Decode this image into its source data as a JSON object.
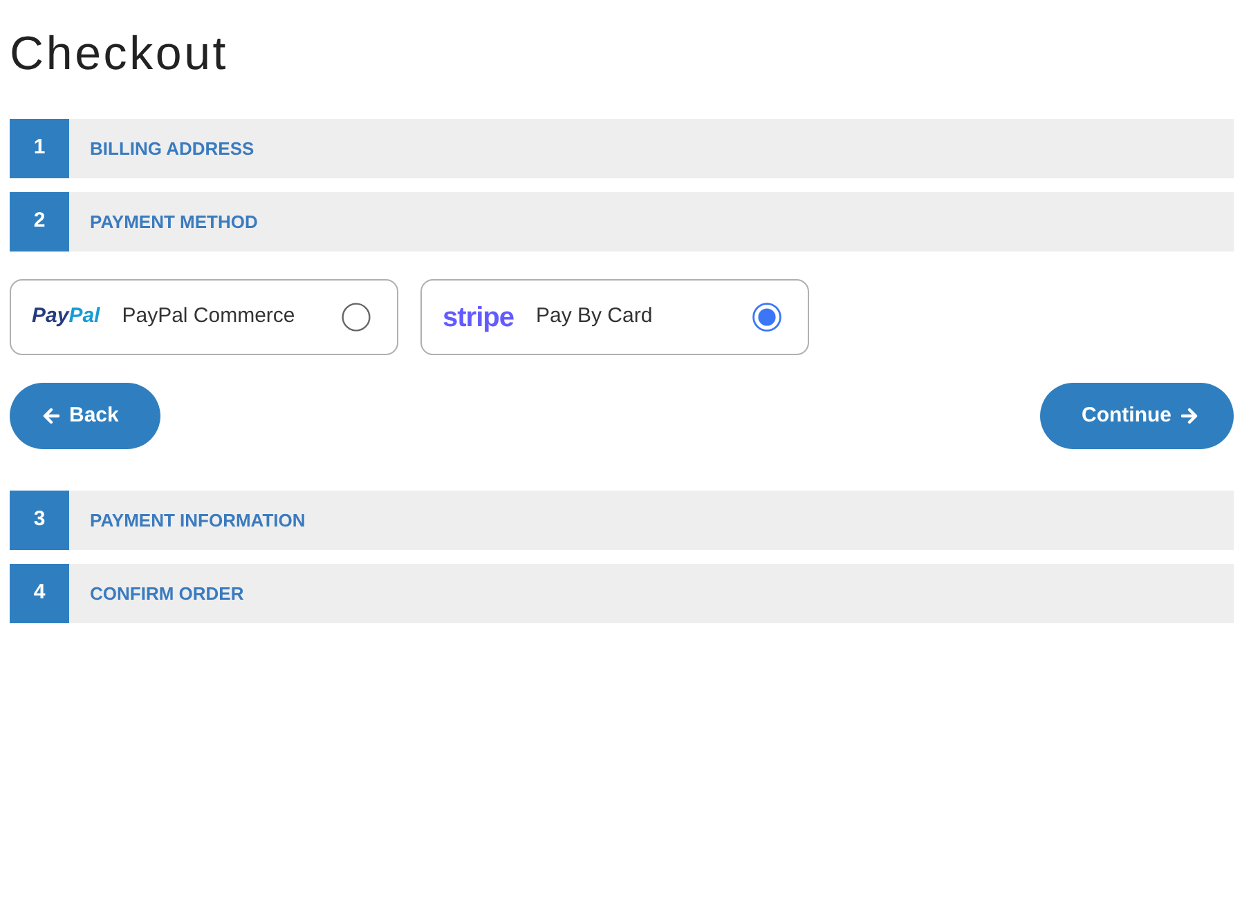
{
  "page_title": "Checkout",
  "steps": [
    {
      "number": "1",
      "label": "BILLING ADDRESS"
    },
    {
      "number": "2",
      "label": "PAYMENT METHOD",
      "body": {
        "payment_options": [
          {
            "kind": "paypal",
            "logo": [
              {
                "text": "Pay",
                "color": "#253b80"
              },
              {
                "text": "Pal",
                "color": "#179bd7"
              }
            ],
            "label": "PayPal Commerce",
            "selected": false
          },
          {
            "kind": "stripe",
            "logo": [
              {
                "text": "stripe",
                "color": "#635bff"
              }
            ],
            "label": "Pay By Card",
            "selected": true
          }
        ],
        "buttons": [
          {
            "kind": "back",
            "label": "Back"
          },
          {
            "kind": "next",
            "label": "Continue"
          }
        ]
      }
    },
    {
      "number": "3",
      "label": "PAYMENT INFORMATION"
    },
    {
      "number": "4",
      "label": "CONFIRM ORDER"
    }
  ]
}
